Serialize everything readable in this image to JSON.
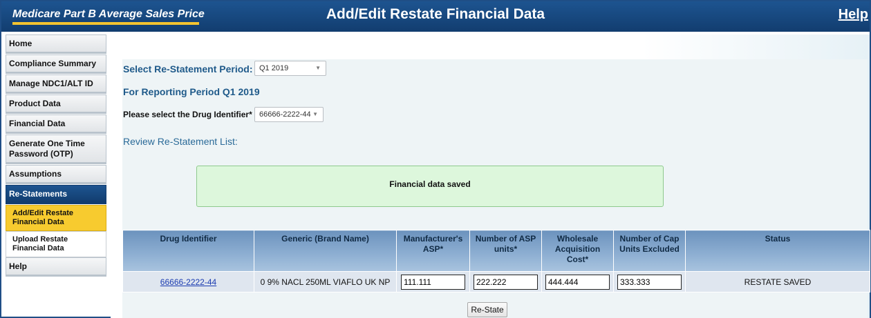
{
  "header": {
    "brand": "Medicare Part B Average Sales Price",
    "title": "Add/Edit Restate Financial Data",
    "help": "Help"
  },
  "sidebar": {
    "items": [
      {
        "label": "Home"
      },
      {
        "label": "Compliance Summary"
      },
      {
        "label": "Manage NDC1/ALT ID"
      },
      {
        "label": "Product Data"
      },
      {
        "label": "Financial Data"
      },
      {
        "label": "Generate One Time Password (OTP)"
      },
      {
        "label": "Assumptions"
      },
      {
        "label": "Re-Statements"
      }
    ],
    "sub_items": [
      {
        "label": "Add/Edit Restate Financial Data"
      },
      {
        "label": "Upload Restate Financial Data"
      }
    ],
    "help": "Help"
  },
  "main": {
    "period_label": "Select Re-Statement Period:",
    "period_value": "Q1 2019",
    "reporting_period": "For Reporting Period Q1 2019",
    "drug_label": "Please select the Drug Identifier* :",
    "drug_value": "66666-2222-44",
    "review_label": "Review Re-Statement List:",
    "message": "Financial data saved",
    "restate_button": "Re-State"
  },
  "table": {
    "headers": [
      "Drug Identifier",
      "Generic (Brand Name)",
      "Manufacturer's ASP*",
      "Number of ASP units*",
      "Wholesale Acquisition Cost*",
      "Number of Cap Units Excluded",
      "Status"
    ],
    "row": {
      "drug_identifier": "66666-2222-44",
      "generic": "0 9% NACL 250ML VIAFLO UK NP",
      "asp": "111.111",
      "asp_units": "222.222",
      "wac": "444.444",
      "cap_units": "333.333",
      "status": "RESTATE SAVED"
    }
  },
  "colors": {
    "header_blue": "#1d5490",
    "active_sub": "#f7cb2f",
    "success_bg": "#ddf7dc"
  },
  "icons": {
    "dropdown": "chevron-down-icon"
  }
}
